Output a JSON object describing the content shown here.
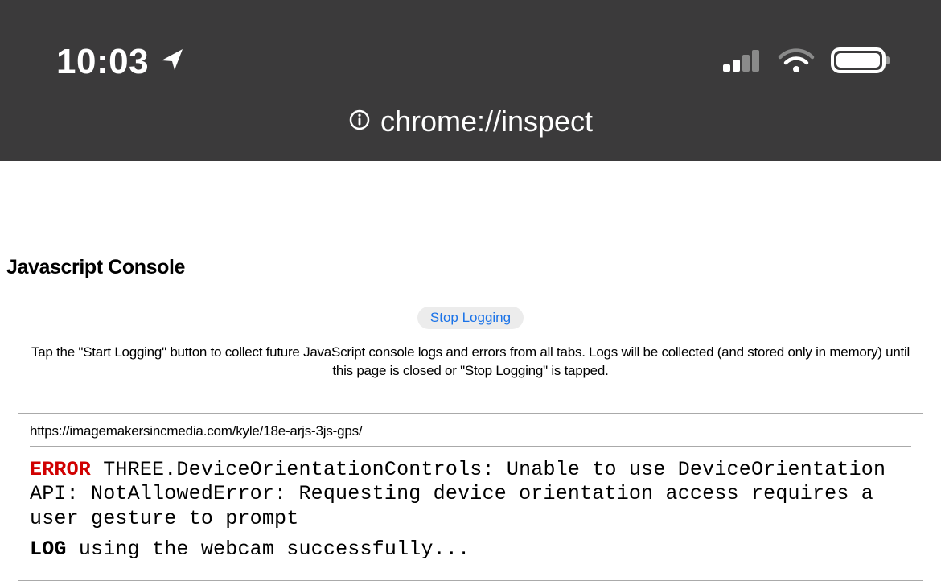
{
  "status": {
    "time": "10:03"
  },
  "urlbar": {
    "url": "chrome://inspect"
  },
  "console": {
    "heading": "Javascript Console",
    "button_label": "Stop Logging",
    "help_text": "Tap the \"Start Logging\" button to collect future JavaScript console logs and errors from all tabs. Logs will be collected (and stored only in memory) until this page is closed or \"Stop Logging\" is tapped.",
    "source_url": "https://imagemakersincmedia.com/kyle/18e-arjs-3js-gps/",
    "entries": [
      {
        "level": "ERROR",
        "message": "THREE.DeviceOrientationControls: Unable to use DeviceOrientation API: NotAllowedError: Requesting device orientation access requires a user gesture to prompt"
      },
      {
        "level": "LOG",
        "message": "using the webcam successfully..."
      }
    ]
  }
}
